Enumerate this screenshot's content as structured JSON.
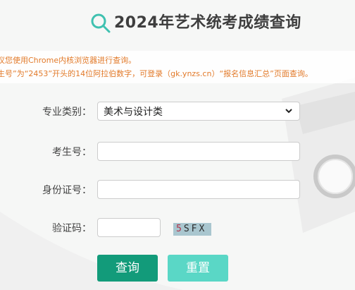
{
  "header": {
    "title": "2024年艺术统考成绩查询",
    "icon": "search-icon"
  },
  "notice": {
    "line1": "议您使用Chrome内核浏览器进行查询。",
    "line2": "生号”为“2453”开头的14位阿拉伯数字，可登录（gk.ynzs.cn）“报名信息汇总”页面查询。"
  },
  "form": {
    "category_label": "专业类别：",
    "category_value": "美术与设计类",
    "exam_no_label": "考生号：",
    "exam_no_value": "",
    "id_label": "身份证号：",
    "id_value": "",
    "captcha_label": "验证码：",
    "captcha_value": "",
    "captcha_first": "5",
    "captcha_rest": "SFX"
  },
  "buttons": {
    "query": "查询",
    "reset": "重置"
  },
  "colors": {
    "accent": "#129b7a",
    "reset": "#5ad7c6",
    "notice": "#e27a2a"
  }
}
